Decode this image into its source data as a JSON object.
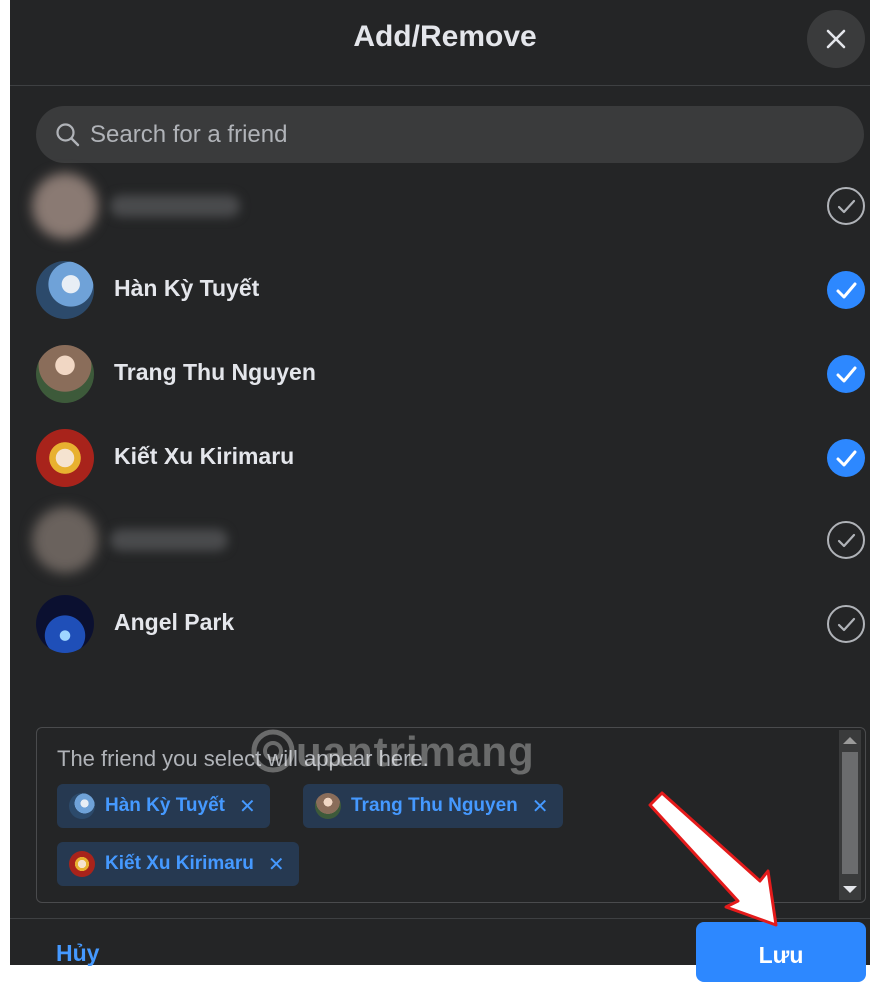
{
  "dialog": {
    "title": "Add/Remove",
    "close_icon": "close-icon"
  },
  "search": {
    "placeholder": "Search for a friend",
    "icon": "search-icon"
  },
  "friends": [
    {
      "name": "",
      "blurred": true,
      "selected": false
    },
    {
      "name": "Hàn Kỳ Tuyết",
      "blurred": false,
      "selected": true
    },
    {
      "name": "Trang Thu Nguyen",
      "blurred": false,
      "selected": true
    },
    {
      "name": "Kiết Xu Kirimaru",
      "blurred": false,
      "selected": true
    },
    {
      "name": "",
      "blurred": true,
      "selected": false
    },
    {
      "name": "Angel Park",
      "blurred": false,
      "selected": false
    }
  ],
  "selected_box": {
    "hint": "The friend you select will appear here.",
    "chips": [
      {
        "label": "Hàn Kỳ Tuyết",
        "remove": "✕"
      },
      {
        "label": "Trang Thu Nguyen",
        "remove": "✕"
      },
      {
        "label": "Kiết Xu Kirimaru",
        "remove": "✕"
      }
    ]
  },
  "footer": {
    "cancel_label": "Hủy",
    "save_label": "Lưu"
  },
  "watermark": "uantrimang",
  "colors": {
    "background": "#242526",
    "accent": "#2d88ff",
    "chip_bg": "#263951",
    "arrow": "#e41b1b"
  }
}
